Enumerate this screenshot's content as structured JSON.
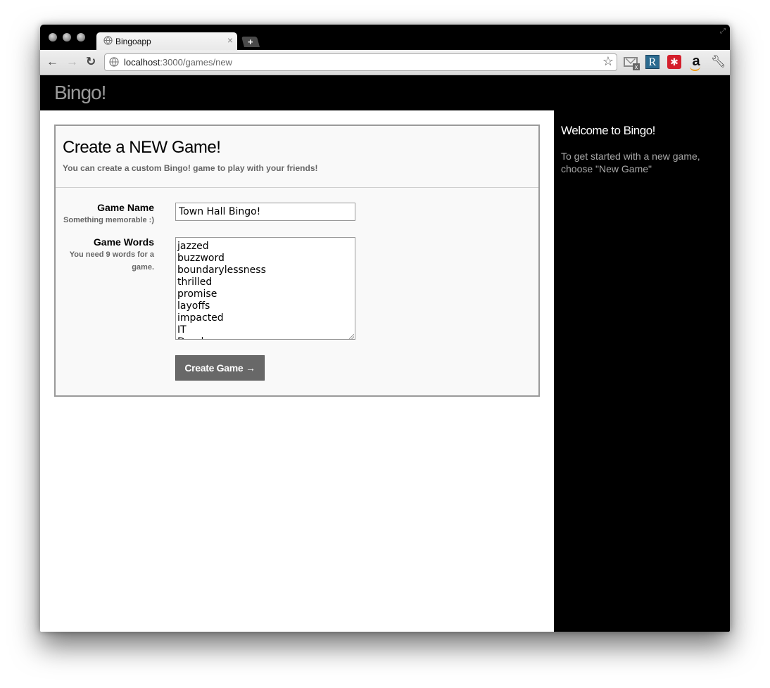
{
  "browser": {
    "tab_title": "Bingoapp",
    "tab_close": "×",
    "new_tab": "+",
    "url_host": "localhost",
    "url_path": ":3000/games/new",
    "icons": [
      "back-icon",
      "forward-icon",
      "reload-icon",
      "globe-icon",
      "star-icon",
      "mail-checker-icon",
      "r-extension-icon",
      "lastpass-icon",
      "amazon-icon",
      "wrench-icon"
    ],
    "ext_r": "R",
    "ext_red": "✱",
    "ext_amazon": "a",
    "ext_mail_badge": "x"
  },
  "header": {
    "brand": "Bingo!"
  },
  "sidebar": {
    "title": "Welcome to Bingo!",
    "text": "To get started with a new game, choose \"New Game\""
  },
  "form": {
    "title": "Create a NEW Game!",
    "subtitle": "You can create a custom Bingo! game to play with your friends!",
    "name_label": "Game Name",
    "name_hint": "Something memorable :)",
    "name_value": "Town Hall Bingo!",
    "words_label": "Game Words",
    "words_hint": "You need 9 words for a game.",
    "words": [
      "jazzed",
      "buzzword",
      "boundarylessness",
      "thrilled",
      "promise",
      "layoffs",
      "impacted",
      "IT",
      "Dundee"
    ],
    "submit_label": "Create Game →"
  }
}
